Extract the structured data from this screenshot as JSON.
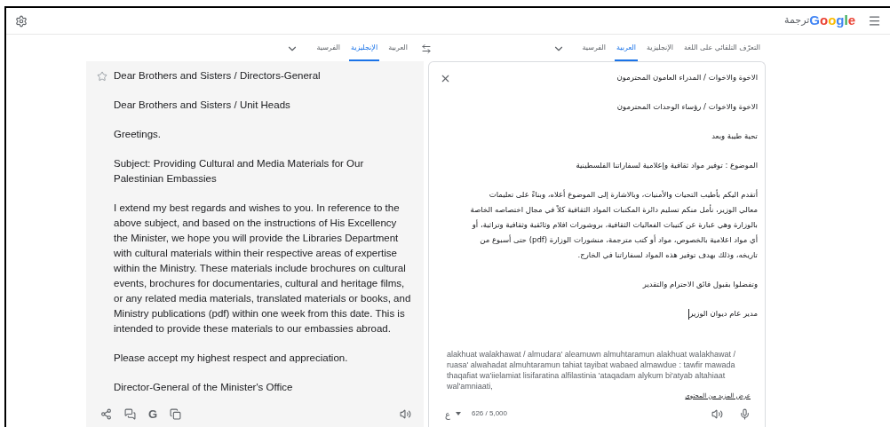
{
  "header": {
    "logo": "Google",
    "app_title": "ترجمة"
  },
  "source_languages": [
    {
      "label": "التعرّف التلقائي على اللغة",
      "selected": false
    },
    {
      "label": "الإنجليزية",
      "selected": false
    },
    {
      "label": "العربية",
      "selected": true
    },
    {
      "label": "الفرسية",
      "selected": false
    }
  ],
  "target_languages": [
    {
      "label": "العربية",
      "selected": false
    },
    {
      "label": "الإنجليزية",
      "selected": true
    },
    {
      "label": "الفرسية",
      "selected": false
    }
  ],
  "source": {
    "paragraphs": [
      "الاخوة والاخوات / المدراء العامون المحترمون",
      "الاخوة والاخوات / رؤساء الوحدات المحترمون",
      "تحية طيبة وبعد",
      "الموضوع : توفير مواد ثقافية وإعلامية لسفاراتنا الفلسطينية",
      "أتقدم اليكم بأطيب التحيات والأمنيات، وبالاشارة إلى الموضوع أعلاه، وبناءً على تعليمات معالي الوزير، نأمل منكم تسليم دائرة المكتبات المواد الثقافية كلاً في مجال اختصاصه الخاصة بالوزارة وهي عبارة عن كتيبات الفعاليات الثقافية، بروشورات افلام وثائقية وثقافية وتراثية، أو أي مواد اعلامية بالخصوص، مواد أو كتب مترجمة، منشورات الوزارة (pdf) حتى أسبوع من تاريخه، وذلك بهدف توفير هذه المواد لسفاراتنا في الخارج.",
      "وتفضلوا بقبول فائق الاحترام والتقدير",
      "مدير عام ديوان الوزير"
    ],
    "transliteration": "alakhuat walakhawat / almudara' aleamuwn almuhtaramun alakhuat walakhawat / ruasa' alwahadat almuhtaramun tahiat tayibat wabaed almawdue : tawfir mawada thaqafiat wa'iielamiat lisifaratina alfilastinia 'ataqadam alykum bi'atyab altahiaat wal'amniaati,",
    "more_link": "عرض المزيد من المحتوى",
    "input_tool": "ع",
    "char_count": "626 / 5,000"
  },
  "translation": {
    "paragraphs": [
      "Dear Brothers and Sisters / Directors-General",
      "Dear Brothers and Sisters / Unit Heads",
      "Greetings.",
      "Subject: Providing Cultural and Media Materials for Our Palestinian Embassies",
      "I extend my best regards and wishes to you. In reference to the above subject, and based on the instructions of His Excellency the Minister, we hope you will provide the Libraries Department with cultural materials within their respective areas of expertise within the Ministry. These materials include brochures on cultural events, brochures for documentaries, cultural and heritage films, or any related media materials, translated materials or books, and Ministry publications (pdf) within one week from this date. This is intended to provide these materials to our embassies abroad.",
      "Please accept my highest respect and appreciation.",
      "Director-General of the Minister's Office"
    ],
    "google_button": "G"
  }
}
